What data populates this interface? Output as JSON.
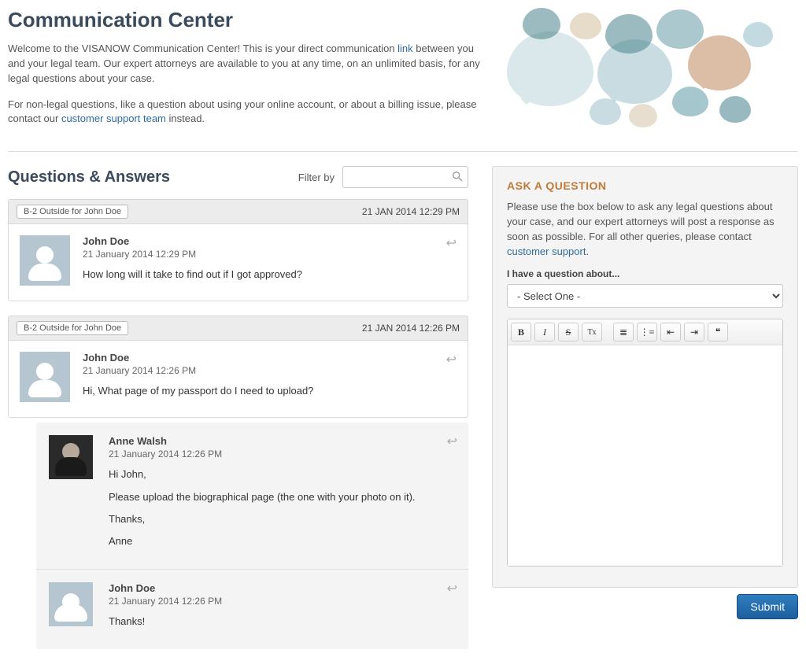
{
  "header": {
    "title": "Communication Center",
    "intro1_a": "Welcome to the VISANOW Communication Center! This is your direct communication ",
    "intro1_link": "link",
    "intro1_b": " between you and your legal team. Our expert attorneys are available to you at any time, on an unlimited basis, for any legal questions about your case.",
    "intro2_a": "For non-legal questions, like a question about using your online account, or about a billing issue, please contact our ",
    "intro2_link": "customer support team",
    "intro2_b": " instead."
  },
  "qa": {
    "heading": "Questions & Answers",
    "filter_label": "Filter by",
    "threads": [
      {
        "case_tag": "B-2 Outside for John Doe",
        "timestamp": "21 JAN 2014 12:29 PM",
        "message": {
          "author": "John Doe",
          "date": "21 January 2014 12:29 PM",
          "body": [
            "How long will it take to find out if I got approved?"
          ]
        },
        "replies": []
      },
      {
        "case_tag": "B-2 Outside for John Doe",
        "timestamp": "21 JAN 2014 12:26 PM",
        "message": {
          "author": "John Doe",
          "date": "21 January 2014 12:26 PM",
          "body": [
            "Hi, What page of my passport do I need to upload?"
          ]
        },
        "replies": [
          {
            "author": "Anne Walsh",
            "date": "21 January 2014 12:26 PM",
            "avatar": "photo",
            "body": [
              "Hi John,",
              "Please upload the biographical page (the one with your photo on it).",
              "Thanks,",
              "Anne"
            ]
          },
          {
            "author": "John Doe",
            "date": "21 January 2014 12:26 PM",
            "avatar": "silhouette",
            "body": [
              "Thanks!"
            ]
          }
        ]
      }
    ]
  },
  "ask": {
    "heading": "ASK A QUESTION",
    "intro_a": "Please use the box below to ask any legal questions about your case, and our expert attorneys will post a response as soon as possible. For all other queries, please contact ",
    "intro_link": "customer support",
    "intro_b": ".",
    "field_label": "I have a question about...",
    "select_placeholder": "- Select One -",
    "submit_label": "Submit"
  },
  "toolbar": {
    "bold": "B",
    "italic": "I",
    "strike": "S",
    "clear": "Tx",
    "olist": "≣",
    "ulist": "⋮≡",
    "outdent": "⇤",
    "indent": "⇥",
    "quote": "❝"
  }
}
